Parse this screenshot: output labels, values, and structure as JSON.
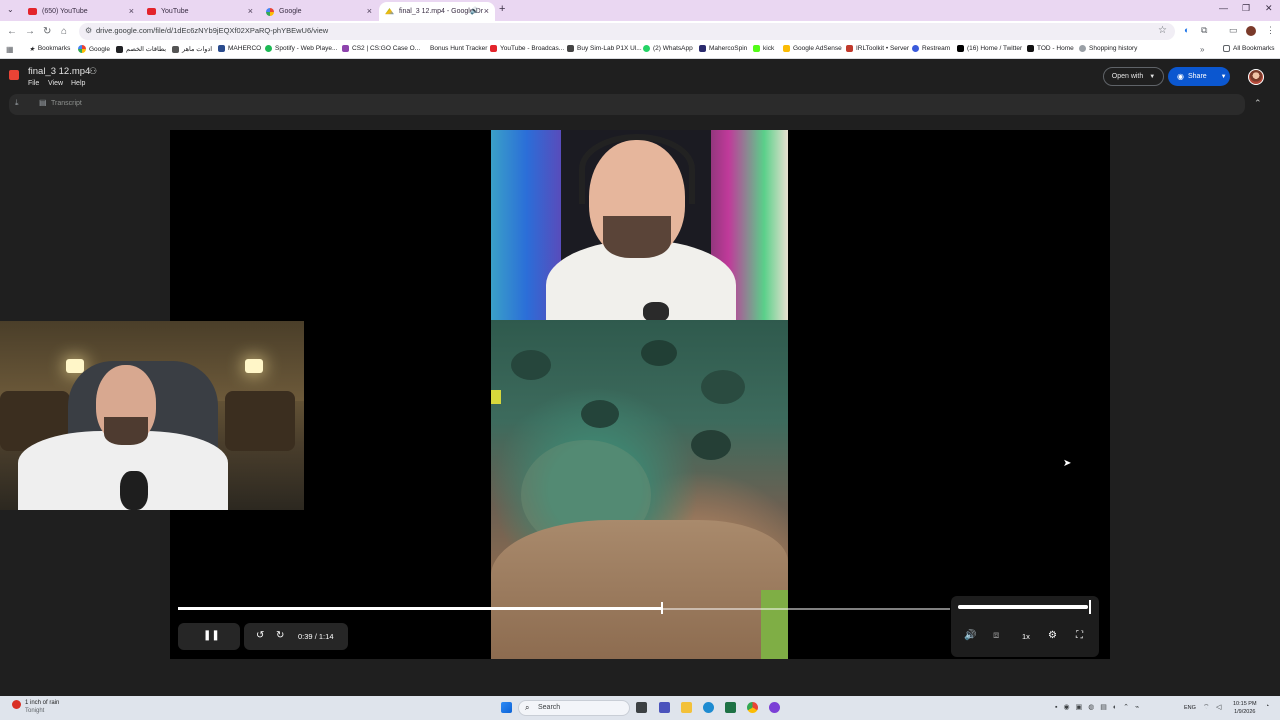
{
  "browser": {
    "tabs": [
      {
        "label": "(650) YouTube",
        "icon": "youtube-icon"
      },
      {
        "label": "YouTube",
        "icon": "youtube-icon"
      },
      {
        "label": "Google",
        "icon": "google-icon"
      },
      {
        "label": "final_3 12.mp4 - Google Dr",
        "icon": "drive-icon",
        "active": true
      }
    ],
    "url": "drive.google.com/file/d/1dEc6zNYb9jEQXf02XPaRQ-phYBEwU6/view",
    "bookmarks_label": "Bookmarks",
    "bookmarks": [
      "Google",
      "بطاقات الخصم",
      "ادوات ماهر",
      "MAHERCO",
      "Spotify - Web Playe...",
      "CS2 | CS:GO Case O...",
      "Bonus Hunt Tracker",
      "YouTube - Broadcas...",
      "Buy Sim-Lab P1X Ul...",
      "(2) WhatsApp",
      "MahercoSpin",
      "kick",
      "Google AdSense",
      "IRLToolkit • Server",
      "Restream",
      "(16) Home / Twitter",
      "TOD - Home",
      "Shopping history"
    ],
    "all_bookmarks": "All Bookmarks"
  },
  "drive": {
    "file_title": "final_3 12.mp4",
    "menu": [
      "File",
      "View",
      "Help"
    ],
    "open_with": "Open with",
    "share": "Share",
    "transcript": "Transcript"
  },
  "player": {
    "current_time": "0:39",
    "duration": "1:14",
    "time_separator": "/",
    "progress": 0.627,
    "volume": 1.0,
    "speed": "1x"
  },
  "taskbar": {
    "weather_line1": "1 inch of rain",
    "weather_line2": "Tonight",
    "search": "Search",
    "language": "ENG",
    "time": "10:15 PM",
    "date": "1/9/2026"
  }
}
